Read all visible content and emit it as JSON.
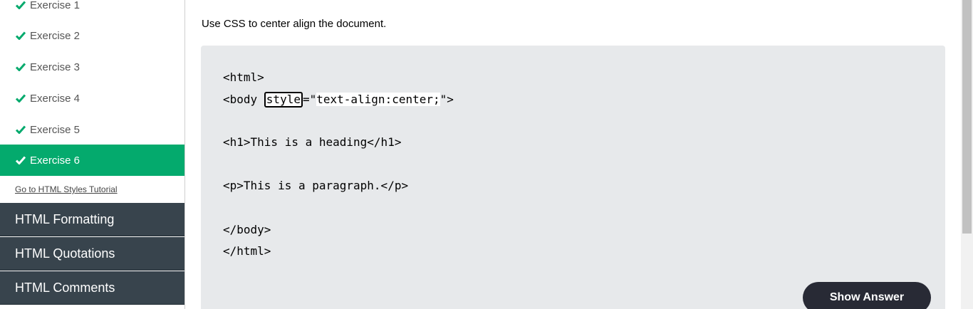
{
  "sidebar": {
    "exercises": [
      {
        "label": "Exercise 1",
        "active": false
      },
      {
        "label": "Exercise 2",
        "active": false
      },
      {
        "label": "Exercise 3",
        "active": false
      },
      {
        "label": "Exercise 4",
        "active": false
      },
      {
        "label": "Exercise 5",
        "active": false
      },
      {
        "label": "Exercise 6",
        "active": true
      }
    ],
    "tutorial_link": "Go to HTML Styles Tutorial",
    "sections": [
      {
        "label": "HTML Formatting"
      },
      {
        "label": "HTML Quotations"
      },
      {
        "label": "HTML Comments"
      }
    ]
  },
  "exercise": {
    "instruction": "Use CSS to center align the document.",
    "code": {
      "line1": "<html>",
      "line2_prefix": "<body ",
      "answer_input": "style",
      "line2_equals": "=\"",
      "line2_value": "text-align:center;",
      "line2_suffix": "\">",
      "line3": "<h1>This is a heading</h1>",
      "line4": "<p>This is a paragraph.</p>",
      "line5": "</body>",
      "line6": "</html>"
    },
    "show_answer_label": "Show Answer"
  },
  "colors": {
    "accent": "#04aa6d",
    "sidebar_dark": "#38444d",
    "code_background": "#e7e9eb",
    "button_dark": "#282a35"
  },
  "icons": {
    "exercise_status": "check-icon"
  }
}
